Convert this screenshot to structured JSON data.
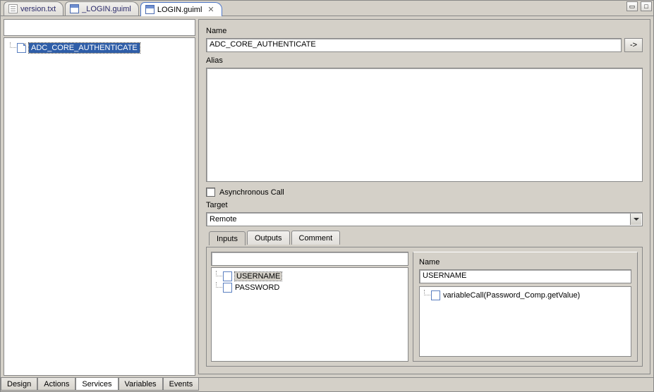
{
  "file_tabs": [
    {
      "label": "version.txt",
      "icon": "txt",
      "active": false,
      "closable": false
    },
    {
      "label": "_LOGIN.guiml",
      "icon": "guiml",
      "active": false,
      "closable": false
    },
    {
      "label": "LOGIN.guiml",
      "icon": "guiml",
      "active": true,
      "closable": true
    }
  ],
  "left_filter": "",
  "services_tree": {
    "items": [
      {
        "label": "ADC_CORE_AUTHENTICATE",
        "selected": true
      }
    ]
  },
  "form": {
    "name_label": "Name",
    "name_value": "ADC_CORE_AUTHENTICATE",
    "goto_button": "->",
    "alias_label": "Alias",
    "alias_value": "",
    "async_label": "Asynchronous Call",
    "async_checked": false,
    "target_label": "Target",
    "target_value": "Remote"
  },
  "inner_tabs": [
    {
      "label": "Inputs",
      "active": true
    },
    {
      "label": "Outputs",
      "active": false
    },
    {
      "label": "Comment",
      "active": false
    }
  ],
  "params_filter": "",
  "params": [
    {
      "label": "USERNAME",
      "selected": true
    },
    {
      "label": "PASSWORD",
      "selected": false
    }
  ],
  "detail": {
    "name_label": "Name",
    "name_value": "USERNAME",
    "expressions": [
      {
        "label": "variableCall(Password_Comp.getValue)"
      }
    ]
  },
  "bottom_tabs": [
    {
      "label": "Design",
      "active": false
    },
    {
      "label": "Actions",
      "active": false
    },
    {
      "label": "Services",
      "active": true
    },
    {
      "label": "Variables",
      "active": false
    },
    {
      "label": "Events",
      "active": false
    }
  ]
}
